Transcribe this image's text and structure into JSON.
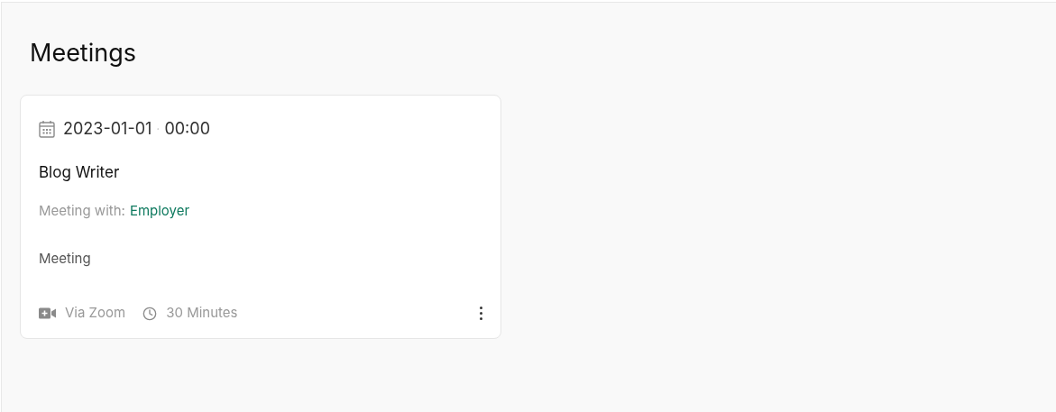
{
  "page": {
    "title": "Meetings"
  },
  "meetings": [
    {
      "date": "2023-01-01",
      "separator": "·",
      "time": "00:00",
      "title": "Blog Writer",
      "with_label": "Meeting with:",
      "with_value": "Employer",
      "description": "Meeting",
      "platform": "Via Zoom",
      "duration": "30 Minutes"
    }
  ]
}
